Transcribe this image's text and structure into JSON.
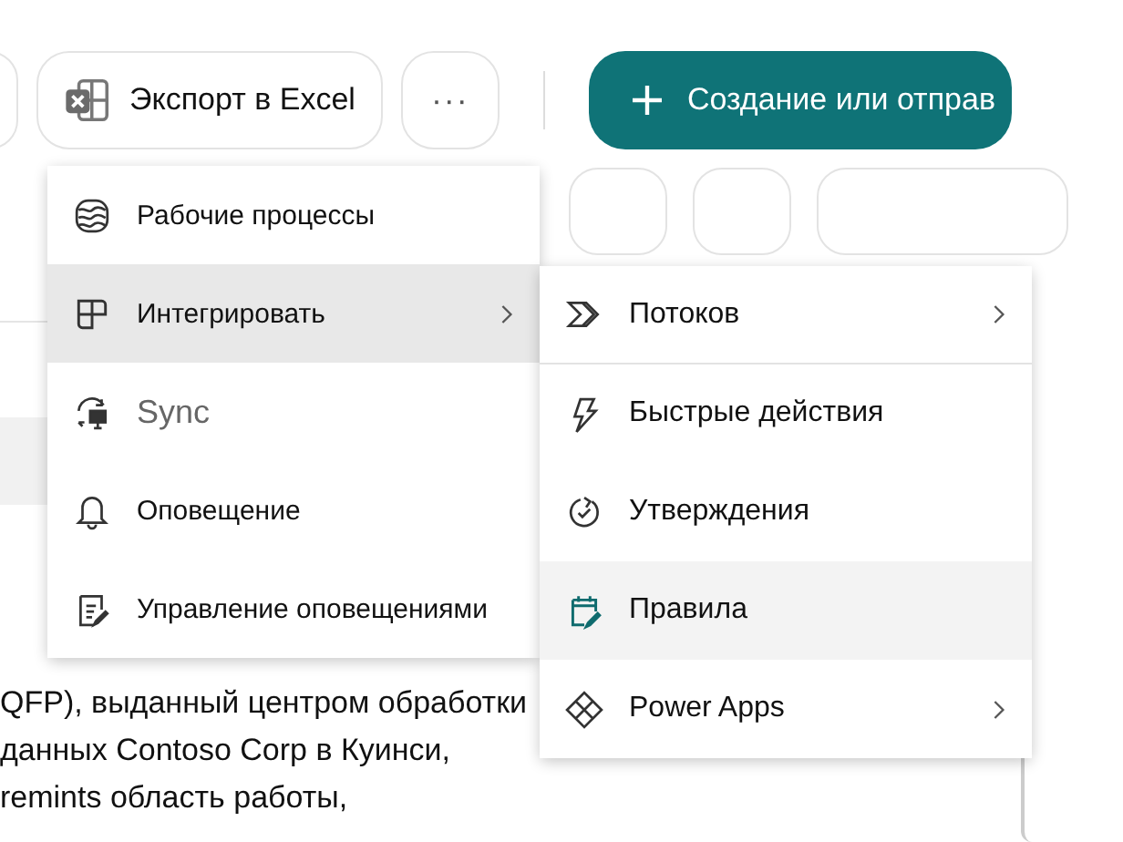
{
  "toolbar": {
    "export_button": "Экспорт в Excel",
    "more_button": "···",
    "create_button": "Создание или отправ"
  },
  "menu": {
    "items": [
      {
        "label": "Рабочие процессы",
        "selected": false,
        "disabled": false,
        "submenu": false
      },
      {
        "label": "Интегрировать",
        "selected": true,
        "disabled": false,
        "submenu": true
      },
      {
        "label": "Sync",
        "selected": false,
        "disabled": true,
        "submenu": false
      },
      {
        "label": "Оповещение",
        "selected": false,
        "disabled": false,
        "submenu": false
      },
      {
        "label": "Управление оповещениями",
        "selected": false,
        "disabled": false,
        "submenu": false
      }
    ]
  },
  "submenu": {
    "items": [
      {
        "label": "Потоков",
        "selected": false,
        "submenu": true
      },
      {
        "label": "Быстрые действия",
        "selected": false,
        "submenu": false
      },
      {
        "label": "Утверждения",
        "selected": false,
        "submenu": false
      },
      {
        "label": "Правила",
        "selected": true,
        "submenu": false
      },
      {
        "label": "Power Apps",
        "selected": false,
        "submenu": true
      }
    ]
  },
  "body_text": [
    "QFP), выданный центром обработки",
    "данных Contoso Corp в Куинси,",
    "remints область работы,"
  ]
}
